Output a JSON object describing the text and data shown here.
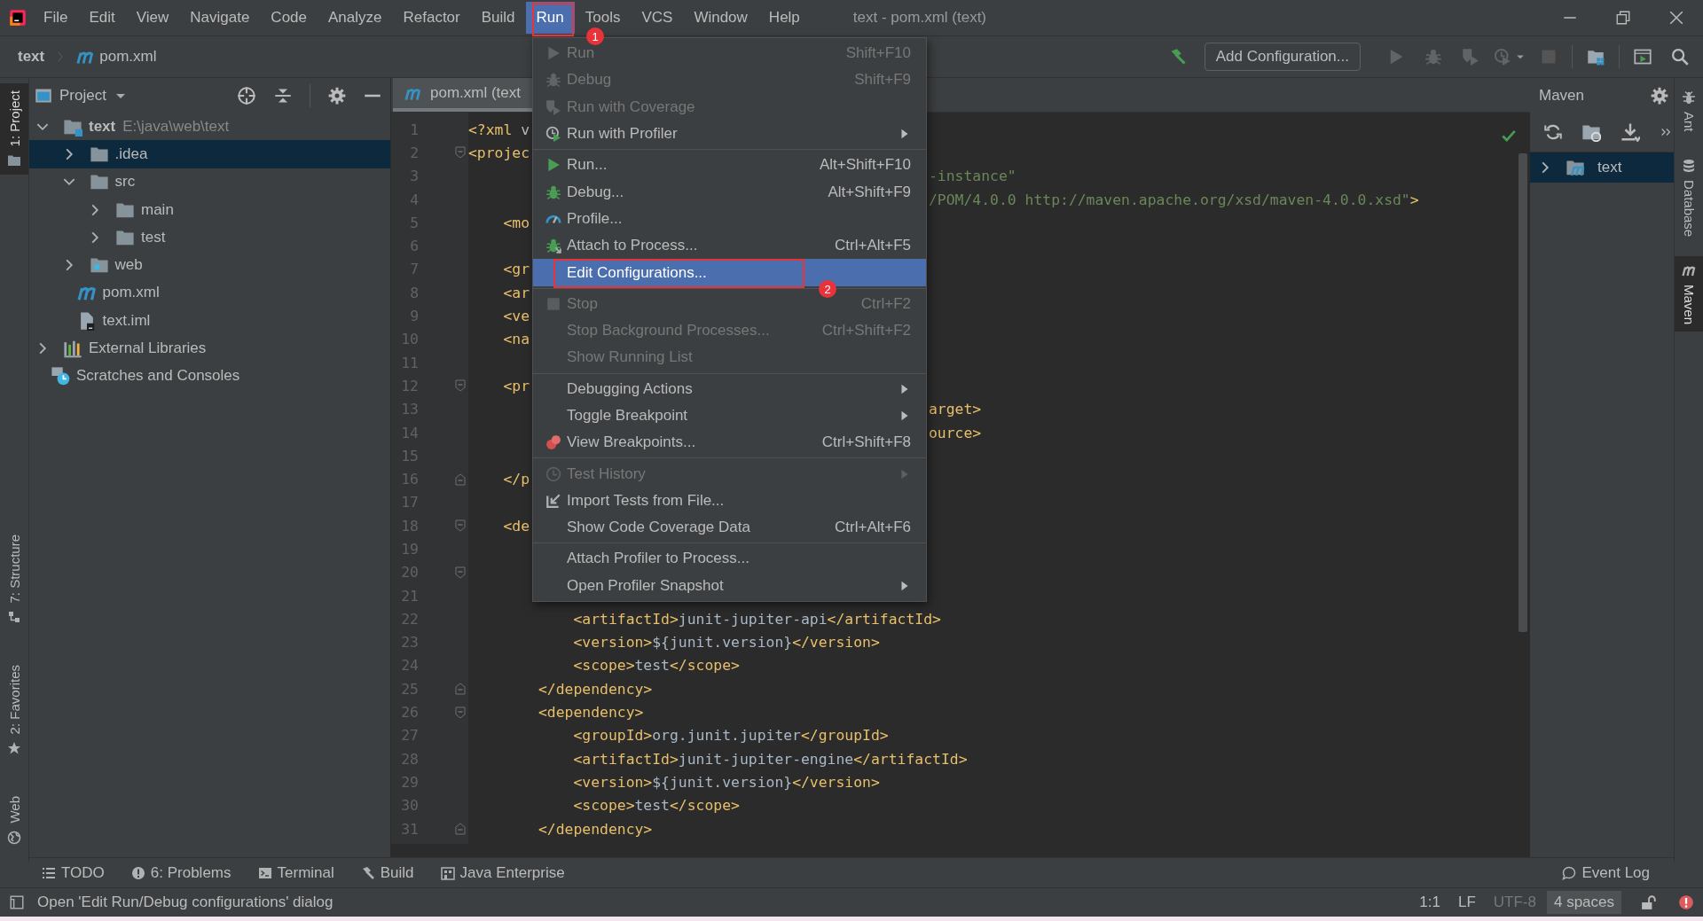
{
  "window": {
    "title": "text - pom.xml (text)"
  },
  "menu_bar": [
    {
      "label": "File",
      "selected": false
    },
    {
      "label": "Edit",
      "selected": false
    },
    {
      "label": "View",
      "selected": false
    },
    {
      "label": "Navigate",
      "selected": false
    },
    {
      "label": "Code",
      "selected": false
    },
    {
      "label": "Analyze",
      "selected": false
    },
    {
      "label": "Refactor",
      "selected": false
    },
    {
      "label": "Build",
      "selected": false
    },
    {
      "label": "Run",
      "selected": true
    },
    {
      "label": "Tools",
      "selected": false
    },
    {
      "label": "VCS",
      "selected": false
    },
    {
      "label": "Window",
      "selected": false
    },
    {
      "label": "Help",
      "selected": false
    }
  ],
  "navigation_bar": {
    "breadcrumb": [
      {
        "label": "text",
        "kind": "project"
      },
      {
        "label": "pom.xml",
        "kind": "maven-file"
      }
    ],
    "run_configuration": "Add Configuration..."
  },
  "left_stripe": {
    "top": [
      {
        "label": "1: Project",
        "kind": "folder",
        "selected": true
      }
    ],
    "bottom": [
      {
        "label": "7: Structure",
        "kind": "structure",
        "selected": false
      },
      {
        "label": "2: Favorites",
        "kind": "star",
        "selected": false
      },
      {
        "label": "Web",
        "kind": "globe",
        "selected": false
      }
    ]
  },
  "project_panel": {
    "title": "Project",
    "tree": [
      {
        "label": "text",
        "kind": "module",
        "path": "E:\\java\\web\\text",
        "expanded": true,
        "selected": false,
        "children": [
          {
            "label": ".idea",
            "kind": "folder",
            "expanded": false,
            "selected": true
          },
          {
            "label": "src",
            "kind": "folder",
            "expanded": true,
            "selected": false,
            "children": [
              {
                "label": "main",
                "kind": "folder",
                "expanded": false,
                "selected": false
              },
              {
                "label": "test",
                "kind": "folder",
                "expanded": false,
                "selected": false
              }
            ]
          },
          {
            "label": "web",
            "kind": "web-folder",
            "expanded": false,
            "selected": false
          },
          {
            "label": "pom.xml",
            "kind": "maven-file",
            "selected": false
          },
          {
            "label": "text.iml",
            "kind": "iml-file",
            "selected": false
          }
        ]
      },
      {
        "label": "External Libraries",
        "kind": "libraries",
        "expanded": false,
        "selected": false
      },
      {
        "label": "Scratches and Consoles",
        "kind": "scratches",
        "selected": false
      }
    ]
  },
  "editor": {
    "tabs": [
      {
        "label": "pom.xml (text",
        "selected": true
      }
    ],
    "lines": [
      {
        "number": "1",
        "kind": "plain",
        "left": [
          {
            "kind": "tag",
            "text": "<?xml"
          },
          {
            "kind": "attr",
            "text": " v"
          }
        ]
      },
      {
        "number": "2",
        "kind": "fold-start",
        "left": [
          {
            "kind": "tag",
            "text": "<projec"
          }
        ]
      },
      {
        "number": "3",
        "kind": "plain",
        "right": [
          {
            "kind": "string",
            "text": "-instance\""
          }
        ]
      },
      {
        "number": "4",
        "kind": "plain",
        "right": [
          {
            "kind": "string",
            "text": "/POM/4.0.0 http://maven.apache.org/xsd/maven-4.0.0.xsd\""
          },
          {
            "kind": "tag",
            "text": ">"
          }
        ]
      },
      {
        "number": "5",
        "kind": "plain",
        "left": [
          {
            "kind": "tag",
            "text": "    <mo"
          }
        ]
      },
      {
        "number": "6",
        "kind": "plain"
      },
      {
        "number": "7",
        "kind": "plain",
        "left": [
          {
            "kind": "tag",
            "text": "    <gr"
          }
        ]
      },
      {
        "number": "8",
        "kind": "plain",
        "left": [
          {
            "kind": "tag",
            "text": "    <ar"
          }
        ]
      },
      {
        "number": "9",
        "kind": "plain",
        "left": [
          {
            "kind": "tag",
            "text": "    <ve"
          }
        ]
      },
      {
        "number": "10",
        "kind": "plain",
        "left": [
          {
            "kind": "tag",
            "text": "    <na"
          }
        ]
      },
      {
        "number": "11",
        "kind": "plain"
      },
      {
        "number": "12",
        "kind": "fold-start",
        "left": [
          {
            "kind": "tag",
            "text": "    <pr"
          }
        ]
      },
      {
        "number": "13",
        "kind": "plain",
        "right": [
          {
            "kind": "tag",
            "text": "arget>"
          }
        ]
      },
      {
        "number": "14",
        "kind": "plain",
        "right": [
          {
            "kind": "tag",
            "text": "ource>"
          }
        ]
      },
      {
        "number": "15",
        "kind": "plain"
      },
      {
        "number": "16",
        "kind": "fold-end",
        "left": [
          {
            "kind": "tag",
            "text": "    </p"
          }
        ]
      },
      {
        "number": "17",
        "kind": "plain"
      },
      {
        "number": "18",
        "kind": "fold-start",
        "left": [
          {
            "kind": "tag",
            "text": "    <de"
          }
        ]
      },
      {
        "number": "19",
        "kind": "plain"
      },
      {
        "number": "20",
        "kind": "fold-start"
      },
      {
        "number": "21",
        "kind": "plain"
      },
      {
        "number": "22",
        "kind": "plain",
        "left": [
          {
            "kind": "tag",
            "text": "            <artifactId>"
          },
          {
            "kind": "text",
            "text": "junit-jupiter-api"
          },
          {
            "kind": "tag",
            "text": "</artifactId>"
          }
        ]
      },
      {
        "number": "23",
        "kind": "plain",
        "left": [
          {
            "kind": "tag",
            "text": "            <version>"
          },
          {
            "kind": "text",
            "text": "${junit.version}"
          },
          {
            "kind": "tag",
            "text": "</version>"
          }
        ]
      },
      {
        "number": "24",
        "kind": "plain",
        "left": [
          {
            "kind": "tag",
            "text": "            <scope>"
          },
          {
            "kind": "text",
            "text": "test"
          },
          {
            "kind": "tag",
            "text": "</scope>"
          }
        ]
      },
      {
        "number": "25",
        "kind": "fold-end",
        "left": [
          {
            "kind": "tag",
            "text": "        </dependency>"
          }
        ]
      },
      {
        "number": "26",
        "kind": "fold-start",
        "left": [
          {
            "kind": "tag",
            "text": "        <dependency>"
          }
        ]
      },
      {
        "number": "27",
        "kind": "plain",
        "left": [
          {
            "kind": "tag",
            "text": "            <groupId>"
          },
          {
            "kind": "text",
            "text": "org.junit.jupiter"
          },
          {
            "kind": "tag",
            "text": "</groupId>"
          }
        ]
      },
      {
        "number": "28",
        "kind": "plain",
        "left": [
          {
            "kind": "tag",
            "text": "            <artifactId>"
          },
          {
            "kind": "text",
            "text": "junit-jupiter-engine"
          },
          {
            "kind": "tag",
            "text": "</artifactId>"
          }
        ]
      },
      {
        "number": "29",
        "kind": "plain",
        "left": [
          {
            "kind": "tag",
            "text": "            <version>"
          },
          {
            "kind": "text",
            "text": "${junit.version}"
          },
          {
            "kind": "tag",
            "text": "</version>"
          }
        ]
      },
      {
        "number": "30",
        "kind": "plain",
        "left": [
          {
            "kind": "tag",
            "text": "            <scope>"
          },
          {
            "kind": "text",
            "text": "test"
          },
          {
            "kind": "tag",
            "text": "</scope>"
          }
        ]
      },
      {
        "number": "31",
        "kind": "fold-end",
        "left": [
          {
            "kind": "tag",
            "text": "        </dependency>"
          }
        ]
      }
    ]
  },
  "run_menu": {
    "groups": [
      [
        {
          "label": "Run",
          "shortcut": "Shift+F10",
          "kind": "run",
          "disabled": true,
          "submenu": false,
          "selected": false
        },
        {
          "label": "Debug",
          "shortcut": "Shift+F9",
          "kind": "debug",
          "disabled": true,
          "submenu": false,
          "selected": false
        },
        {
          "label": "Run with Coverage",
          "kind": "coverage",
          "disabled": true,
          "submenu": false,
          "selected": false
        },
        {
          "label": "Run with Profiler",
          "kind": "profiler",
          "disabled": false,
          "submenu": true,
          "selected": false
        }
      ],
      [
        {
          "label": "Run...",
          "shortcut": "Alt+Shift+F10",
          "kind": "run",
          "disabled": false,
          "submenu": false,
          "selected": false
        },
        {
          "label": "Debug...",
          "shortcut": "Alt+Shift+F9",
          "kind": "debug",
          "disabled": false,
          "submenu": false,
          "selected": false
        },
        {
          "label": "Profile...",
          "kind": "gauge",
          "disabled": false,
          "submenu": false,
          "selected": false
        },
        {
          "label": "Attach to Process...",
          "shortcut": "Ctrl+Alt+F5",
          "kind": "attach",
          "disabled": false,
          "submenu": false,
          "selected": false
        },
        {
          "label": "Edit Configurations...",
          "kind": "plain",
          "disabled": false,
          "submenu": false,
          "selected": true
        }
      ],
      [
        {
          "label": "Stop",
          "shortcut": "Ctrl+F2",
          "kind": "stop",
          "disabled": true,
          "submenu": false,
          "selected": false
        },
        {
          "label": "Stop Background Processes...",
          "shortcut": "Ctrl+Shift+F2",
          "kind": "plain",
          "disabled": true,
          "submenu": false,
          "selected": false
        },
        {
          "label": "Show Running List",
          "kind": "plain",
          "disabled": true,
          "submenu": false,
          "selected": false
        }
      ],
      [
        {
          "label": "Debugging Actions",
          "kind": "plain",
          "disabled": false,
          "submenu": true,
          "selected": false
        },
        {
          "label": "Toggle Breakpoint",
          "kind": "plain",
          "disabled": false,
          "submenu": true,
          "selected": false
        },
        {
          "label": "View Breakpoints...",
          "shortcut": "Ctrl+Shift+F8",
          "kind": "breakpoints",
          "disabled": false,
          "submenu": false,
          "selected": false
        }
      ],
      [
        {
          "label": "Test History",
          "kind": "history",
          "disabled": true,
          "submenu": true,
          "selected": false
        },
        {
          "label": "Import Tests from File...",
          "kind": "import",
          "disabled": false,
          "submenu": false,
          "selected": false
        },
        {
          "label": "Show Code Coverage Data",
          "shortcut": "Ctrl+Alt+F6",
          "kind": "plain",
          "disabled": false,
          "submenu": false,
          "selected": false
        }
      ],
      [
        {
          "label": "Attach Profiler to Process...",
          "kind": "plain",
          "disabled": false,
          "submenu": false,
          "selected": false
        },
        {
          "label": "Open Profiler Snapshot",
          "kind": "plain",
          "disabled": false,
          "submenu": true,
          "selected": false
        }
      ]
    ]
  },
  "maven_panel": {
    "title": "Maven",
    "tree": [
      {
        "label": "text",
        "expanded": false,
        "selected": true
      }
    ]
  },
  "right_stripe": [
    {
      "label": "Ant",
      "kind": "ant",
      "selected": false
    },
    {
      "label": "Database",
      "kind": "database",
      "selected": false
    },
    {
      "label": "Maven",
      "kind": "maven",
      "selected": true
    }
  ],
  "tool_windows": {
    "left": [
      {
        "label": "TODO",
        "kind": "list"
      },
      {
        "label": "6: Problems",
        "kind": "problems"
      },
      {
        "label": "Terminal",
        "kind": "terminal"
      },
      {
        "label": "Build",
        "kind": "hammer"
      },
      {
        "label": "Java Enterprise",
        "kind": "enterprise"
      }
    ],
    "right": [
      {
        "label": "Event Log",
        "kind": "event-log"
      }
    ]
  },
  "status_bar": {
    "message": "Open 'Edit Run/Debug configurations' dialog",
    "items": [
      {
        "label": "1:1",
        "disabled": false,
        "selected": false
      },
      {
        "label": "LF",
        "disabled": false,
        "selected": false
      },
      {
        "label": "UTF-8",
        "disabled": true,
        "selected": false
      },
      {
        "label": "4 spaces",
        "disabled": false,
        "selected": true
      }
    ]
  },
  "annotations": [
    {
      "label": "1",
      "kind": "top-menu"
    },
    {
      "label": "2",
      "kind": "menu-item"
    }
  ]
}
